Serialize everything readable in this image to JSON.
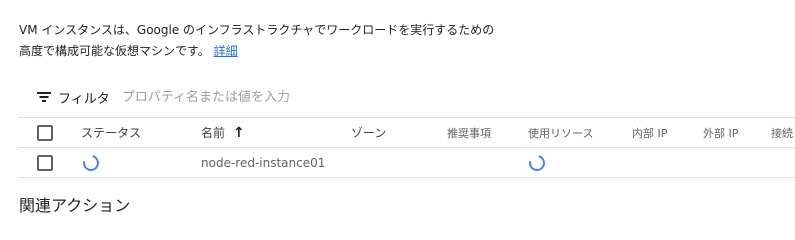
{
  "intro": {
    "line1": "VM インスタンスは、Google のインフラストラクチャでワークロードを実行するための",
    "line2": "高度で構成可能な仮想マシンです。",
    "details_link": "詳細"
  },
  "filter": {
    "label": "フィルタ",
    "placeholder": "プロパティ名または値を入力",
    "icon": "filter-list-icon"
  },
  "table": {
    "columns": {
      "status": "ステータス",
      "name": "名前",
      "zone": "ゾーン",
      "recommendation": "推奨事項",
      "in_use_by": "使用リソース",
      "internal_ip": "内部 IP",
      "external_ip": "外部 IP",
      "connect": "接続"
    },
    "sort_indicator": "↑",
    "rows": [
      {
        "name": "node-red-instance01",
        "status_icon": "loading-spinner-icon",
        "in_use_icon": "loading-spinner-icon"
      }
    ]
  },
  "related_actions": {
    "title": "関連アクション"
  },
  "colors": {
    "link": "#1a73e8",
    "spinner": "#4285f4",
    "divider": "#e0e0e0"
  }
}
